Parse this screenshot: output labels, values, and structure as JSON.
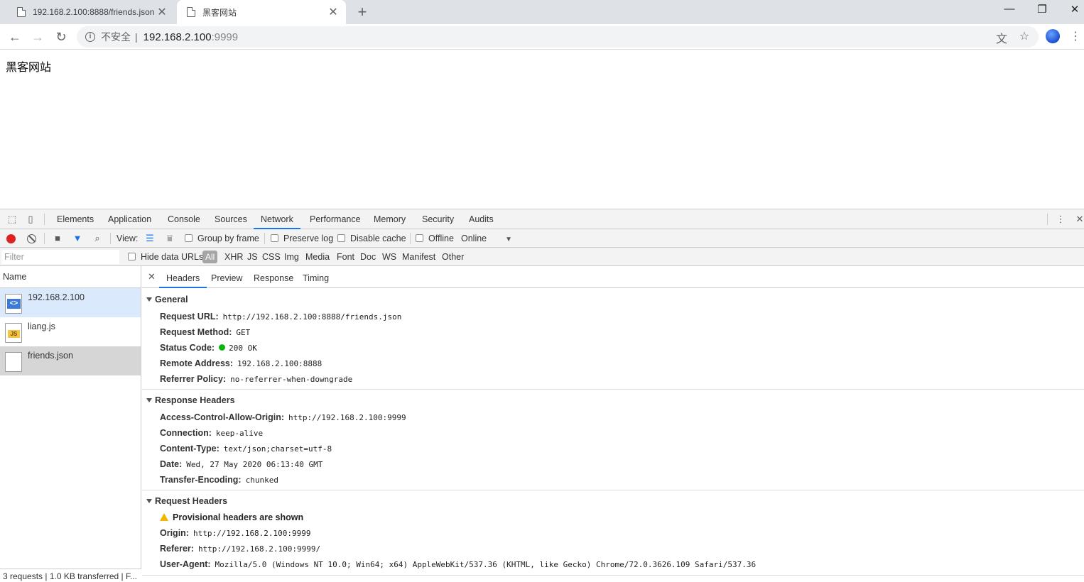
{
  "browser": {
    "tabs": [
      {
        "title": "192.168.2.100:8888/friends.json",
        "active": false
      },
      {
        "title": "黑客网站",
        "active": true
      }
    ],
    "address": {
      "security_label": "不安全",
      "separator": "|",
      "host": "192.168.2.100",
      "port": ":9999"
    }
  },
  "page": {
    "heading": "黑客网站"
  },
  "devtools": {
    "panels": [
      "Elements",
      "Application",
      "Console",
      "Sources",
      "Network",
      "Performance",
      "Memory",
      "Security",
      "Audits"
    ],
    "active_panel": "Network",
    "toolbar": {
      "view_label": "View:",
      "group_by_frame": "Group by frame",
      "preserve_log": "Preserve log",
      "disable_cache": "Disable cache",
      "offline": "Offline",
      "throttle": "Online"
    },
    "filter_bar": {
      "placeholder": "Filter",
      "hide_data_urls": "Hide data URLs",
      "types": [
        "All",
        "XHR",
        "JS",
        "CSS",
        "Img",
        "Media",
        "Font",
        "Doc",
        "WS",
        "Manifest",
        "Other"
      ],
      "active_type": "All"
    },
    "requests": {
      "column": "Name",
      "items": [
        {
          "name": "192.168.2.100",
          "kind": "html"
        },
        {
          "name": "liang.js",
          "kind": "js"
        },
        {
          "name": "friends.json",
          "kind": "blank"
        }
      ],
      "footer": "3 requests  |  1.0 KB transferred  |  F..."
    },
    "detail": {
      "tabs": [
        "Headers",
        "Preview",
        "Response",
        "Timing"
      ],
      "active_tab": "Headers",
      "general": {
        "title": "General",
        "rows": [
          {
            "k": "Request URL:",
            "v": "http://192.168.2.100:8888/friends.json"
          },
          {
            "k": "Request Method:",
            "v": "GET"
          },
          {
            "k": "Status Code:",
            "v": "200 OK"
          },
          {
            "k": "Remote Address:",
            "v": "192.168.2.100:8888"
          },
          {
            "k": "Referrer Policy:",
            "v": "no-referrer-when-downgrade"
          }
        ]
      },
      "response_headers": {
        "title": "Response Headers",
        "rows": [
          {
            "k": "Access-Control-Allow-Origin:",
            "v": "http://192.168.2.100:9999"
          },
          {
            "k": "Connection:",
            "v": "keep-alive"
          },
          {
            "k": "Content-Type:",
            "v": "text/json;charset=utf-8"
          },
          {
            "k": "Date:",
            "v": "Wed, 27 May 2020 06:13:40 GMT"
          },
          {
            "k": "Transfer-Encoding:",
            "v": "chunked"
          }
        ]
      },
      "request_headers": {
        "title": "Request Headers",
        "warning": "Provisional headers are shown",
        "rows": [
          {
            "k": "Origin:",
            "v": "http://192.168.2.100:9999"
          },
          {
            "k": "Referer:",
            "v": "http://192.168.2.100:9999/"
          },
          {
            "k": "User-Agent:",
            "v": "Mozilla/5.0 (Windows NT 10.0; Win64; x64) AppleWebKit/537.36 (KHTML, like Gecko) Chrome/72.0.3626.109 Safari/537.36"
          }
        ]
      }
    }
  }
}
